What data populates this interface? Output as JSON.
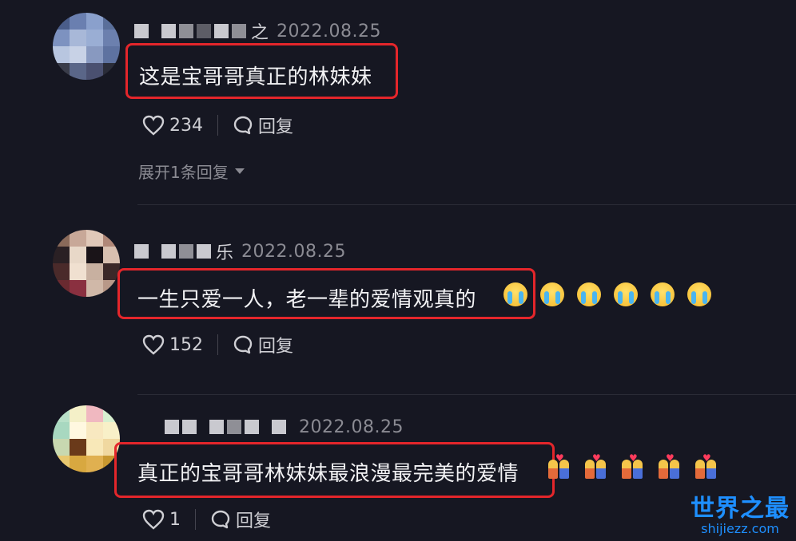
{
  "comments": [
    {
      "name_tail": "之",
      "date": "2022.08.25",
      "text": "这是宝哥哥真正的林妹妹",
      "emojis": [],
      "likes": "234",
      "reply_label": "回复",
      "expand_label": "展开1条回复"
    },
    {
      "name_tail": "乐",
      "date": "2022.08.25",
      "text": "一生只爱一人，老一辈的爱情观真的",
      "emojis": [
        "crying",
        "crying",
        "crying",
        "crying",
        "crying",
        "crying"
      ],
      "likes": "152",
      "reply_label": "回复"
    },
    {
      "name_tail": "",
      "date": "2022.08.25",
      "text": "真正的宝哥哥林妹妹最浪漫最完美的爱情",
      "emojis": [
        "couple-with-heart",
        "couple-with-heart",
        "couple-with-heart",
        "couple-with-heart",
        "couple-with-heart"
      ],
      "likes": "1",
      "reply_label": "回复"
    }
  ],
  "watermark": {
    "title": "世界之最",
    "url": "shijiezz.com"
  },
  "colors": {
    "background": "#161722",
    "highlight": "#e4262b",
    "watermark": "#1e8fff"
  }
}
